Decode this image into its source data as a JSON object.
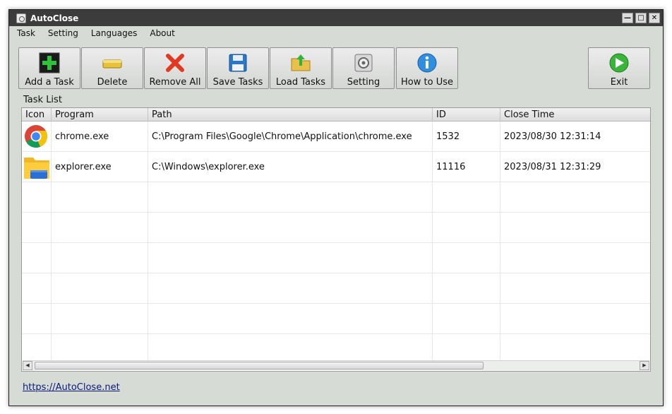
{
  "window": {
    "title": "AutoClose"
  },
  "menu": {
    "items": [
      "Task",
      "Setting",
      "Languages",
      "About"
    ]
  },
  "toolbar": {
    "add": "Add a Task",
    "delete": "Delete",
    "remove_all": "Remove All",
    "save": "Save Tasks",
    "load": "Load Tasks",
    "setting": "Setting",
    "howto": "How to Use",
    "exit": "Exit"
  },
  "task_list": {
    "label": "Task List",
    "columns": [
      "Icon",
      "Program",
      "Path",
      "ID",
      "Close Time"
    ],
    "rows": [
      {
        "icon": "chrome-icon",
        "program": "chrome.exe",
        "path": "C:\\Program Files\\Google\\Chrome\\Application\\chrome.exe",
        "id": "1532",
        "close_time": "2023/08/30 12:31:14"
      },
      {
        "icon": "folder-icon",
        "program": "explorer.exe",
        "path": "C:\\Windows\\explorer.exe",
        "id": "11116",
        "close_time": "2023/08/31 12:31:29"
      }
    ]
  },
  "footer": {
    "link": "https://AutoClose.net"
  },
  "colors": {
    "titlebar": "#3c3c3c",
    "window_bg": "#d6dbd6",
    "link": "#0b1a7a"
  }
}
